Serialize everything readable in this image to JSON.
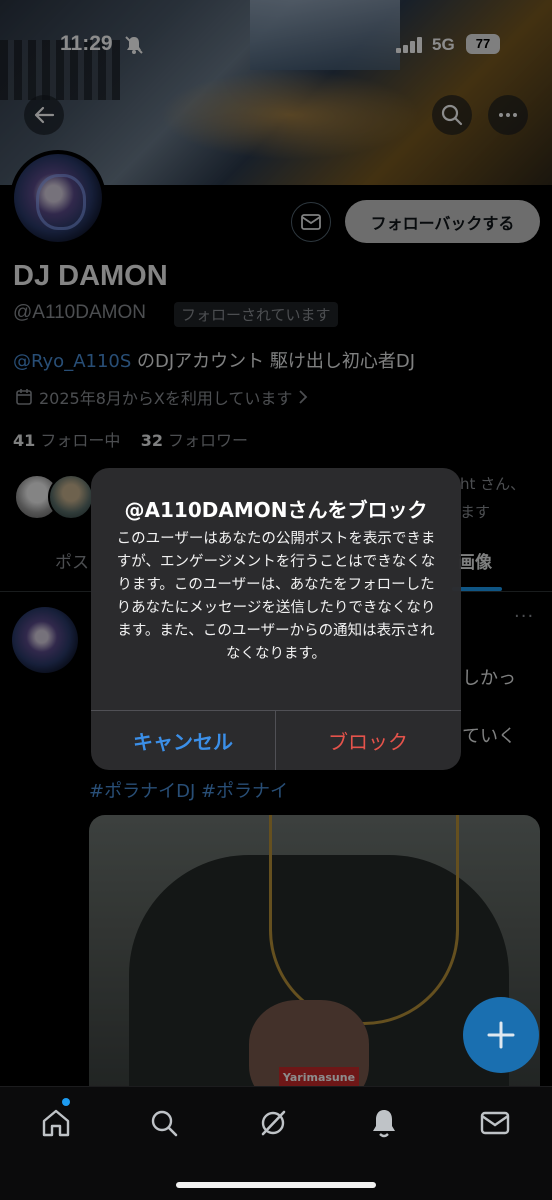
{
  "status_bar": {
    "time": "11:29",
    "network": "5G",
    "battery": "77"
  },
  "profile": {
    "name": "DJ DAMON",
    "handle": "@A110DAMON",
    "follows_you_badge": "フォローされています",
    "follow_back_label": "フォローバックする",
    "bio_mention": "@Ryo_A110S",
    "bio_text": " のDJアカウント 駆け出し初心者DJ",
    "joined": "2025年8月からXを利用しています",
    "following_count": "41",
    "following_label": " フォロー中",
    "followers_count": "32",
    "followers_label": " フォロワー",
    "followed_by_line1": "ht さん、",
    "followed_by_line2": "ます"
  },
  "tabs": {
    "left_partial": "ポス",
    "right_partial": "画像"
  },
  "post": {
    "text_fragment_1": "しかっ",
    "text_fragment_2": "ていく",
    "hashtags": "#ポラナイDJ #ポラナイ",
    "more_label": "···",
    "image_print_label": "Yarimasune"
  },
  "alert": {
    "title": "@A110DAMONさんをブロック",
    "message": "このユーザーはあなたの公開ポストを表示できますが、エンゲージメントを行うことはできなくなります。このユーザーは、あなたをフォローしたりあなたにメッセージを送信したりできなくなります。また、このユーザーからの通知は表示されなくなります。",
    "cancel_label": "キャンセル",
    "block_label": "ブロック"
  },
  "colors": {
    "accent": "#1d9bf0",
    "destructive": "#e5534b",
    "alert_bg": "#2c2c2e"
  }
}
